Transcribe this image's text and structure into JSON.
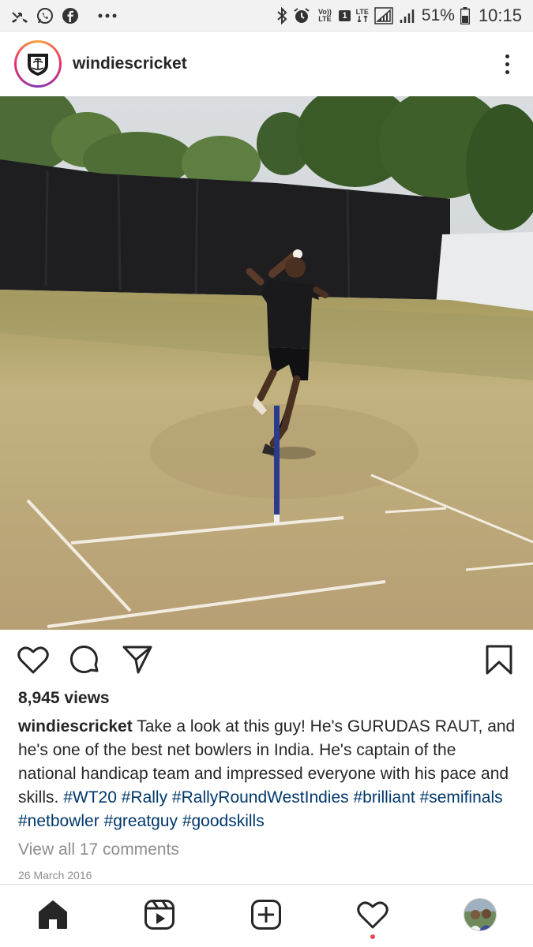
{
  "status_bar": {
    "volte_label": "Vo)) LTE",
    "sim_label": "1",
    "lte_label": "LTE",
    "battery": "51%",
    "time": "10:15"
  },
  "post": {
    "username": "windiescricket",
    "views": "8,945 views",
    "caption": {
      "user": "windiescricket",
      "text": "Take a look at this guy! He's GURUDAS RAUT, and he's one of the best net bowlers in India. He's captain of the national handicap team and impressed everyone with his pace and skills.",
      "hashtags": [
        "#WT20",
        "#Rally",
        "#RallyRoundWestIndies",
        "#brilliant",
        "#semifinals",
        "#netbowler",
        "#greatguy",
        "#goodskills"
      ]
    },
    "view_comments": "View all 17 comments",
    "date": "26 March 2016"
  },
  "icons": {
    "missed_call": "missed-call-icon",
    "whatsapp": "whatsapp-icon",
    "facebook": "facebook-icon",
    "more_notifications": "more-notifications-icon",
    "bluetooth": "bluetooth-icon",
    "alarm": "alarm-icon",
    "signal": "signal-icon",
    "battery": "battery-icon",
    "like": "heart-icon",
    "comment": "comment-icon",
    "share": "send-icon",
    "save": "bookmark-icon",
    "home": "home-icon",
    "reels": "reels-icon",
    "create": "add-post-icon",
    "activity": "heart-icon",
    "profile": "profile-avatar"
  },
  "colors": {
    "hashtag": "#00376b",
    "muted": "#8e8e8e",
    "notification_dot": "#ed4956"
  }
}
